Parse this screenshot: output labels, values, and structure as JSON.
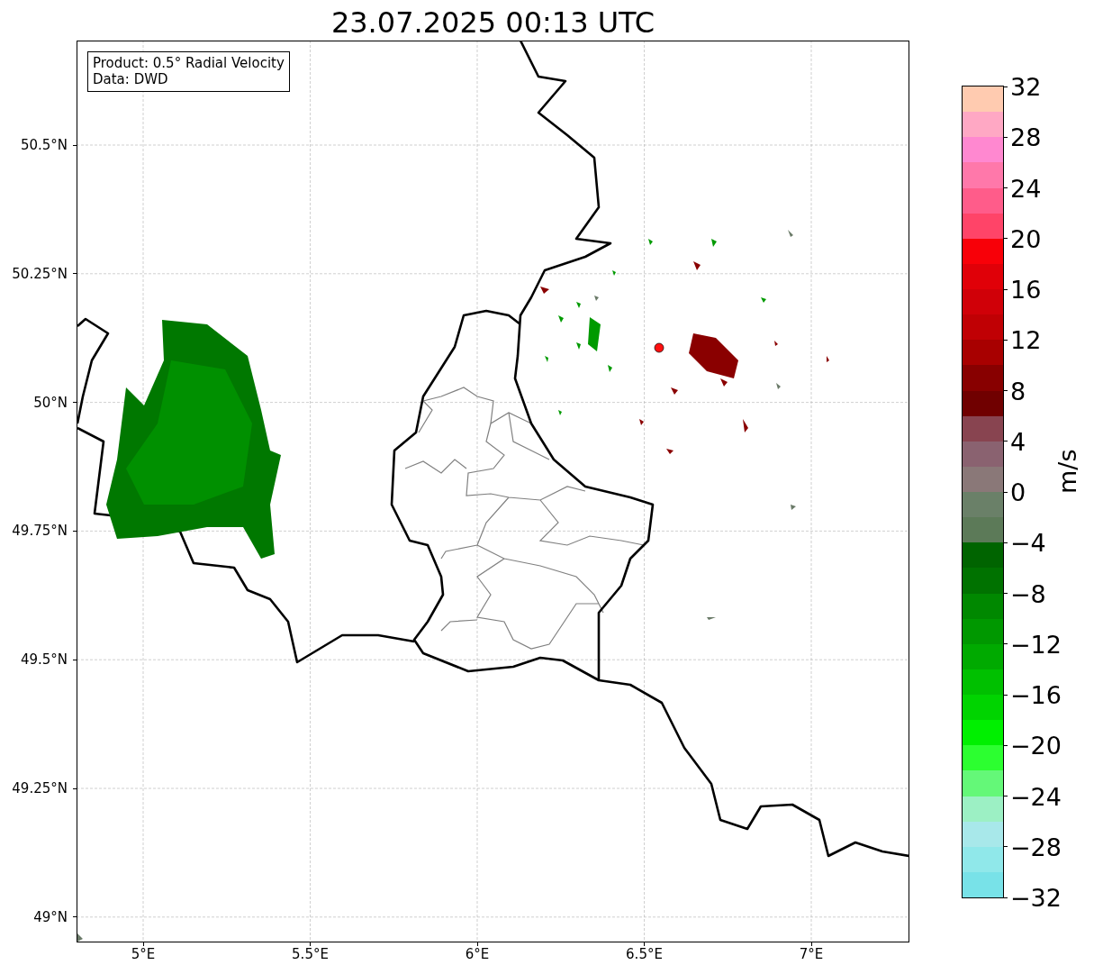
{
  "title": "23.07.2025 00:13 UTC",
  "info_box": {
    "lines": [
      "Product: 0.5° Radial Velocity",
      "Data: DWD"
    ]
  },
  "map": {
    "lat_labels": [
      "50.5°N",
      "50.25°N",
      "50°N",
      "49.75°N",
      "49.5°N",
      "49.25°N",
      "49°N"
    ],
    "lon_labels": [
      "5°E",
      "5.5°E",
      "6°E",
      "6.5°E",
      "7°E"
    ]
  },
  "colorbar": {
    "label": "m/s",
    "ticks": [
      "32",
      "28",
      "24",
      "20",
      "16",
      "12",
      "8",
      "4",
      "0",
      "−4",
      "−8",
      "−12",
      "−16",
      "−20",
      "−24",
      "−28",
      "−32"
    ],
    "segments": [
      {
        "color": "#ffcbb0"
      },
      {
        "color": "#ffa8c4"
      },
      {
        "color": "#ff88d0"
      },
      {
        "color": "#ff78aa"
      },
      {
        "color": "#ff5c8a"
      },
      {
        "color": "#ff4468"
      },
      {
        "color": "#f80008"
      },
      {
        "color": "#e00008"
      },
      {
        "color": "#d00008"
      },
      {
        "color": "#c00004"
      },
      {
        "color": "#a80000"
      },
      {
        "color": "#880000"
      },
      {
        "color": "#700000"
      },
      {
        "color": "#884450"
      },
      {
        "color": "#8a6270"
      },
      {
        "color": "#8a7878"
      },
      {
        "color": "#6a8068"
      },
      {
        "color": "#5c7a58"
      },
      {
        "color": "#006400"
      },
      {
        "color": "#007200"
      },
      {
        "color": "#008800"
      },
      {
        "color": "#009800"
      },
      {
        "color": "#00aa00"
      },
      {
        "color": "#00c000"
      },
      {
        "color": "#00d400"
      },
      {
        "color": "#00f000"
      },
      {
        "color": "#2cff30"
      },
      {
        "color": "#64f878"
      },
      {
        "color": "#9cf0c4"
      },
      {
        "color": "#a8e8ea"
      },
      {
        "color": "#90e8ea"
      },
      {
        "color": "#78e2e8"
      }
    ]
  }
}
